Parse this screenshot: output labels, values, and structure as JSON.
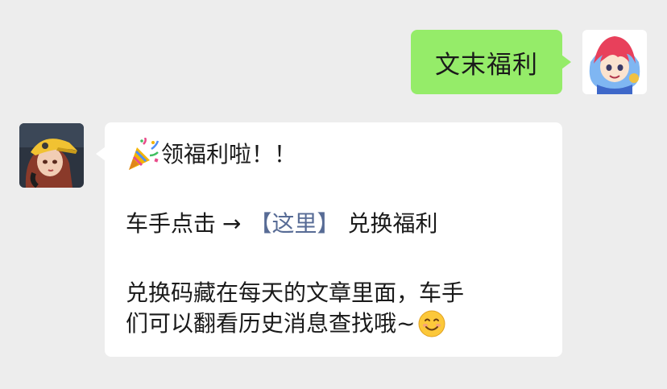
{
  "chat": {
    "outgoing": {
      "text": "文末福利",
      "bubble_color": "#95ec69"
    },
    "incoming": {
      "line1": "领福利啦！！",
      "line1_icon": "party-popper-icon",
      "line2_prefix": "车手点击",
      "line2_arrow": "→",
      "line2_link_open": "【",
      "line2_link": "这里",
      "line2_link_close": "】",
      "line2_suffix": "兑换福利",
      "line3": "兑换码藏在每天的文章里面，车手",
      "line4": "们可以翻看历史消息查找哦~",
      "line4_icon": "smiling-face-icon",
      "link_color": "#576b95"
    },
    "background_color": "#ededed"
  }
}
